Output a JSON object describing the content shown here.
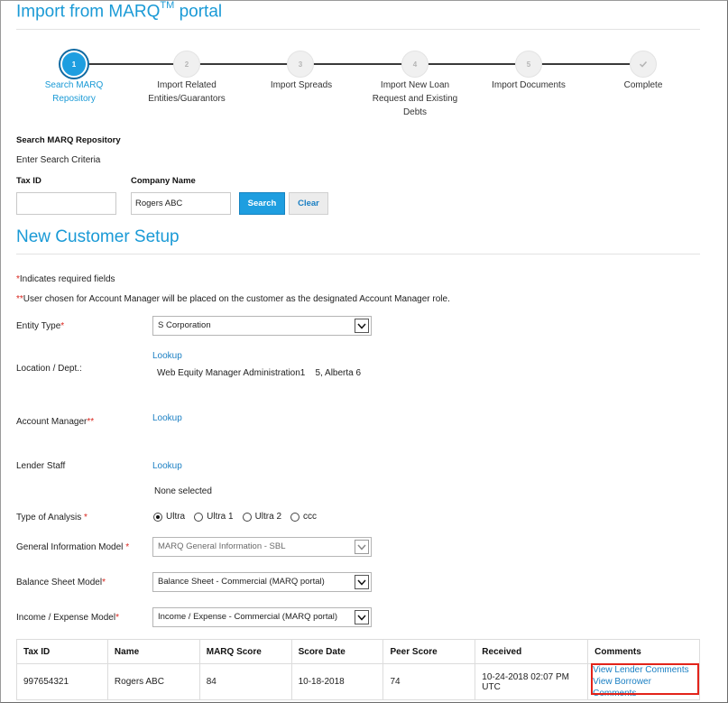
{
  "page": {
    "title": "Import from MARQ",
    "title_sup": "TM",
    "title_suffix": "portal"
  },
  "stepper": {
    "steps": [
      {
        "number": "1",
        "label_lines": [
          "Search MARQ",
          "Repository"
        ],
        "state": "active"
      },
      {
        "number": "2",
        "label_lines": [
          "Import Related",
          "Entities/Guarantors"
        ],
        "state": "pending"
      },
      {
        "number": "3",
        "label_lines": [
          "Import Spreads"
        ],
        "state": "pending"
      },
      {
        "number": "4",
        "label_lines": [
          "Import New Loan",
          "Request and Existing",
          "Debts"
        ],
        "state": "pending"
      },
      {
        "number": "5",
        "label_lines": [
          "Import Documents"
        ],
        "state": "pending"
      },
      {
        "number": "",
        "label_lines": [
          "Complete"
        ],
        "state": "complete-icon"
      }
    ]
  },
  "search": {
    "heading": "Search MARQ Repository",
    "subheading": "Enter Search Criteria",
    "tax_id_label": "Tax ID",
    "tax_id_value": "",
    "company_name_label": "Company Name",
    "company_name_value": "Rogers ABC",
    "search_button": "Search",
    "clear_button": "Clear"
  },
  "setup": {
    "heading": "New Customer Setup",
    "note1_marker": "*",
    "note1_text": "Indicates required fields",
    "note2_marker": "**",
    "note2_text": "User chosen for Account Manager will be placed on the customer as the designated Account Manager role.",
    "entity_type_label": "Entity Type",
    "entity_type_req": "*",
    "entity_type_value": "S Corporation",
    "location_label": "Location / Dept.:",
    "location_lookup": "Lookup",
    "location_value": "Web Equity Manager Administration1    5, Alberta 6",
    "account_manager_label": "Account Manager",
    "account_manager_req": "**",
    "account_manager_lookup": "Lookup",
    "lender_staff_label": "Lender Staff",
    "lender_staff_lookup": "Lookup",
    "lender_staff_value": "None selected",
    "analysis_label": "Type of Analysis",
    "analysis_req": "*",
    "analysis_options": [
      {
        "label": "Ultra",
        "selected": true
      },
      {
        "label": "Ultra 1",
        "selected": false
      },
      {
        "label": "Ultra 2",
        "selected": false
      },
      {
        "label": "ccc",
        "selected": false
      }
    ],
    "gim_label": "General Information Model",
    "gim_req": "*",
    "gim_value": "MARQ General Information - SBL",
    "bsm_label": "Balance Sheet Model",
    "bsm_req": "*",
    "bsm_value": "Balance Sheet - Commercial (MARQ portal)",
    "iem_label": "Income / Expense Model",
    "iem_req": "*",
    "iem_value": "Income / Expense - Commercial (MARQ portal)"
  },
  "results": {
    "columns": [
      "Tax ID",
      "Name",
      "MARQ Score",
      "Score Date",
      "Peer Score",
      "Received",
      "Comments"
    ],
    "rows": [
      {
        "tax_id": "997654321",
        "name": "Rogers ABC",
        "marq_score": "84",
        "score_date": "10-18-2018",
        "peer_score": "74",
        "received": "10-24-2018 02:07 PM UTC",
        "comment_links": [
          "View Lender Comments",
          "View Borrower Comments"
        ]
      }
    ]
  },
  "colors": {
    "accent": "#1a9ad6",
    "link": "#1a7fc3",
    "required": "#d9251d",
    "highlight": "#e2231a"
  }
}
